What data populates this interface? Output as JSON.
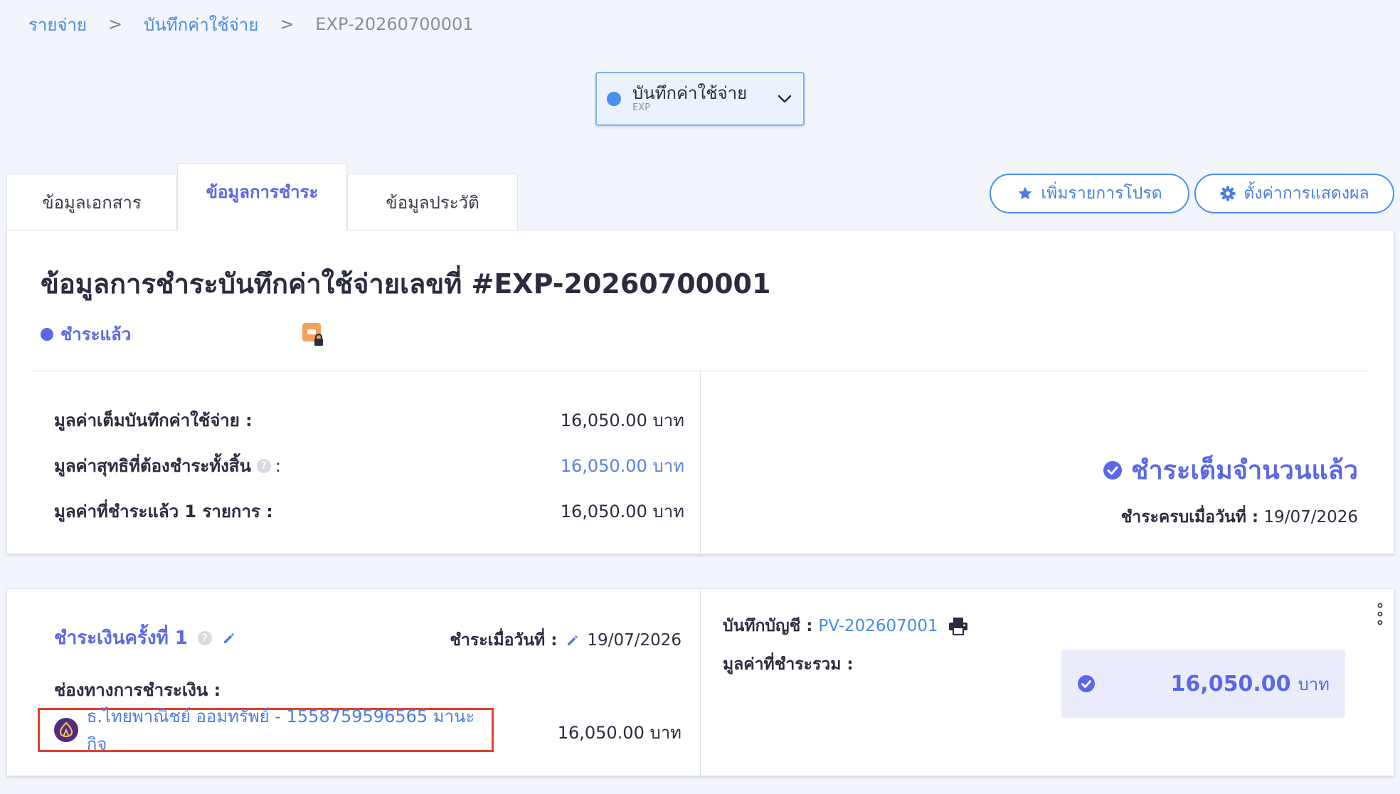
{
  "breadcrumb": {
    "items": [
      "รายจ่าย",
      "บันทึกค่าใช้จ่าย"
    ],
    "separator": ">",
    "current": "EXP-20260700001"
  },
  "doc_type": {
    "label": "บันทึกค่าใช้จ่าย",
    "code": "EXP",
    "dot_color": "#4a8ef0"
  },
  "tabs": [
    {
      "label": "ข้อมูลเอกสาร",
      "active": false
    },
    {
      "label": "ข้อมูลการชำระ",
      "active": true
    },
    {
      "label": "ข้อมูลประวัติ",
      "active": false
    }
  ],
  "actions": {
    "favorite": "เพิ่มรายการโปรด",
    "settings": "ตั้งค่าการแสดงผล"
  },
  "summary": {
    "title": "ข้อมูลการชำระบันทึกค่าใช้จ่ายเลขที่ #EXP-20260700001",
    "status": "ชำระแล้ว",
    "rows": [
      {
        "label": "มูลค่าเต็มบันทึกค่าใช้จ่าย :",
        "value": "16,050.00 บาท"
      },
      {
        "label": "มูลค่าสุทธิที่ต้องชำระทั้งสิ้น",
        "suffix": ":",
        "value": "16,050.00 บาท"
      },
      {
        "label": "มูลค่าที่ชำระแล้ว 1 รายการ :",
        "value": "16,050.00 บาท"
      }
    ],
    "full_paid": "ชำระเต็มจำนวนแล้ว",
    "paid_complete_label": "ชำระครบเมื่อวันที่ :",
    "paid_complete_date": "19/07/2026"
  },
  "payment": {
    "round_label": "ชำระเงินครั้งที่ 1",
    "paid_on_label": "ชำระเมื่อวันที่ :",
    "paid_on_date": "19/07/2026",
    "channel_label": "ช่องทางการชำระเงิน :",
    "channel_name": "ธ.ไทยพาณิชย์ ออมทรัพย์ - 1558759596565 มานะกิจ",
    "channel_amount": "16,050.00 บาท",
    "journal_label": "บันทึกบัญชี :",
    "journal_ref": "PV-202607001",
    "total_label": "มูลค่าที่ชำระรวม :",
    "total_amount": "16,050.00",
    "total_unit": "บาท"
  },
  "colors": {
    "accent": "#5b67e6",
    "link": "#4a8be0",
    "highlight_border": "#e1402a",
    "lock_badge": "#f0a25a"
  }
}
